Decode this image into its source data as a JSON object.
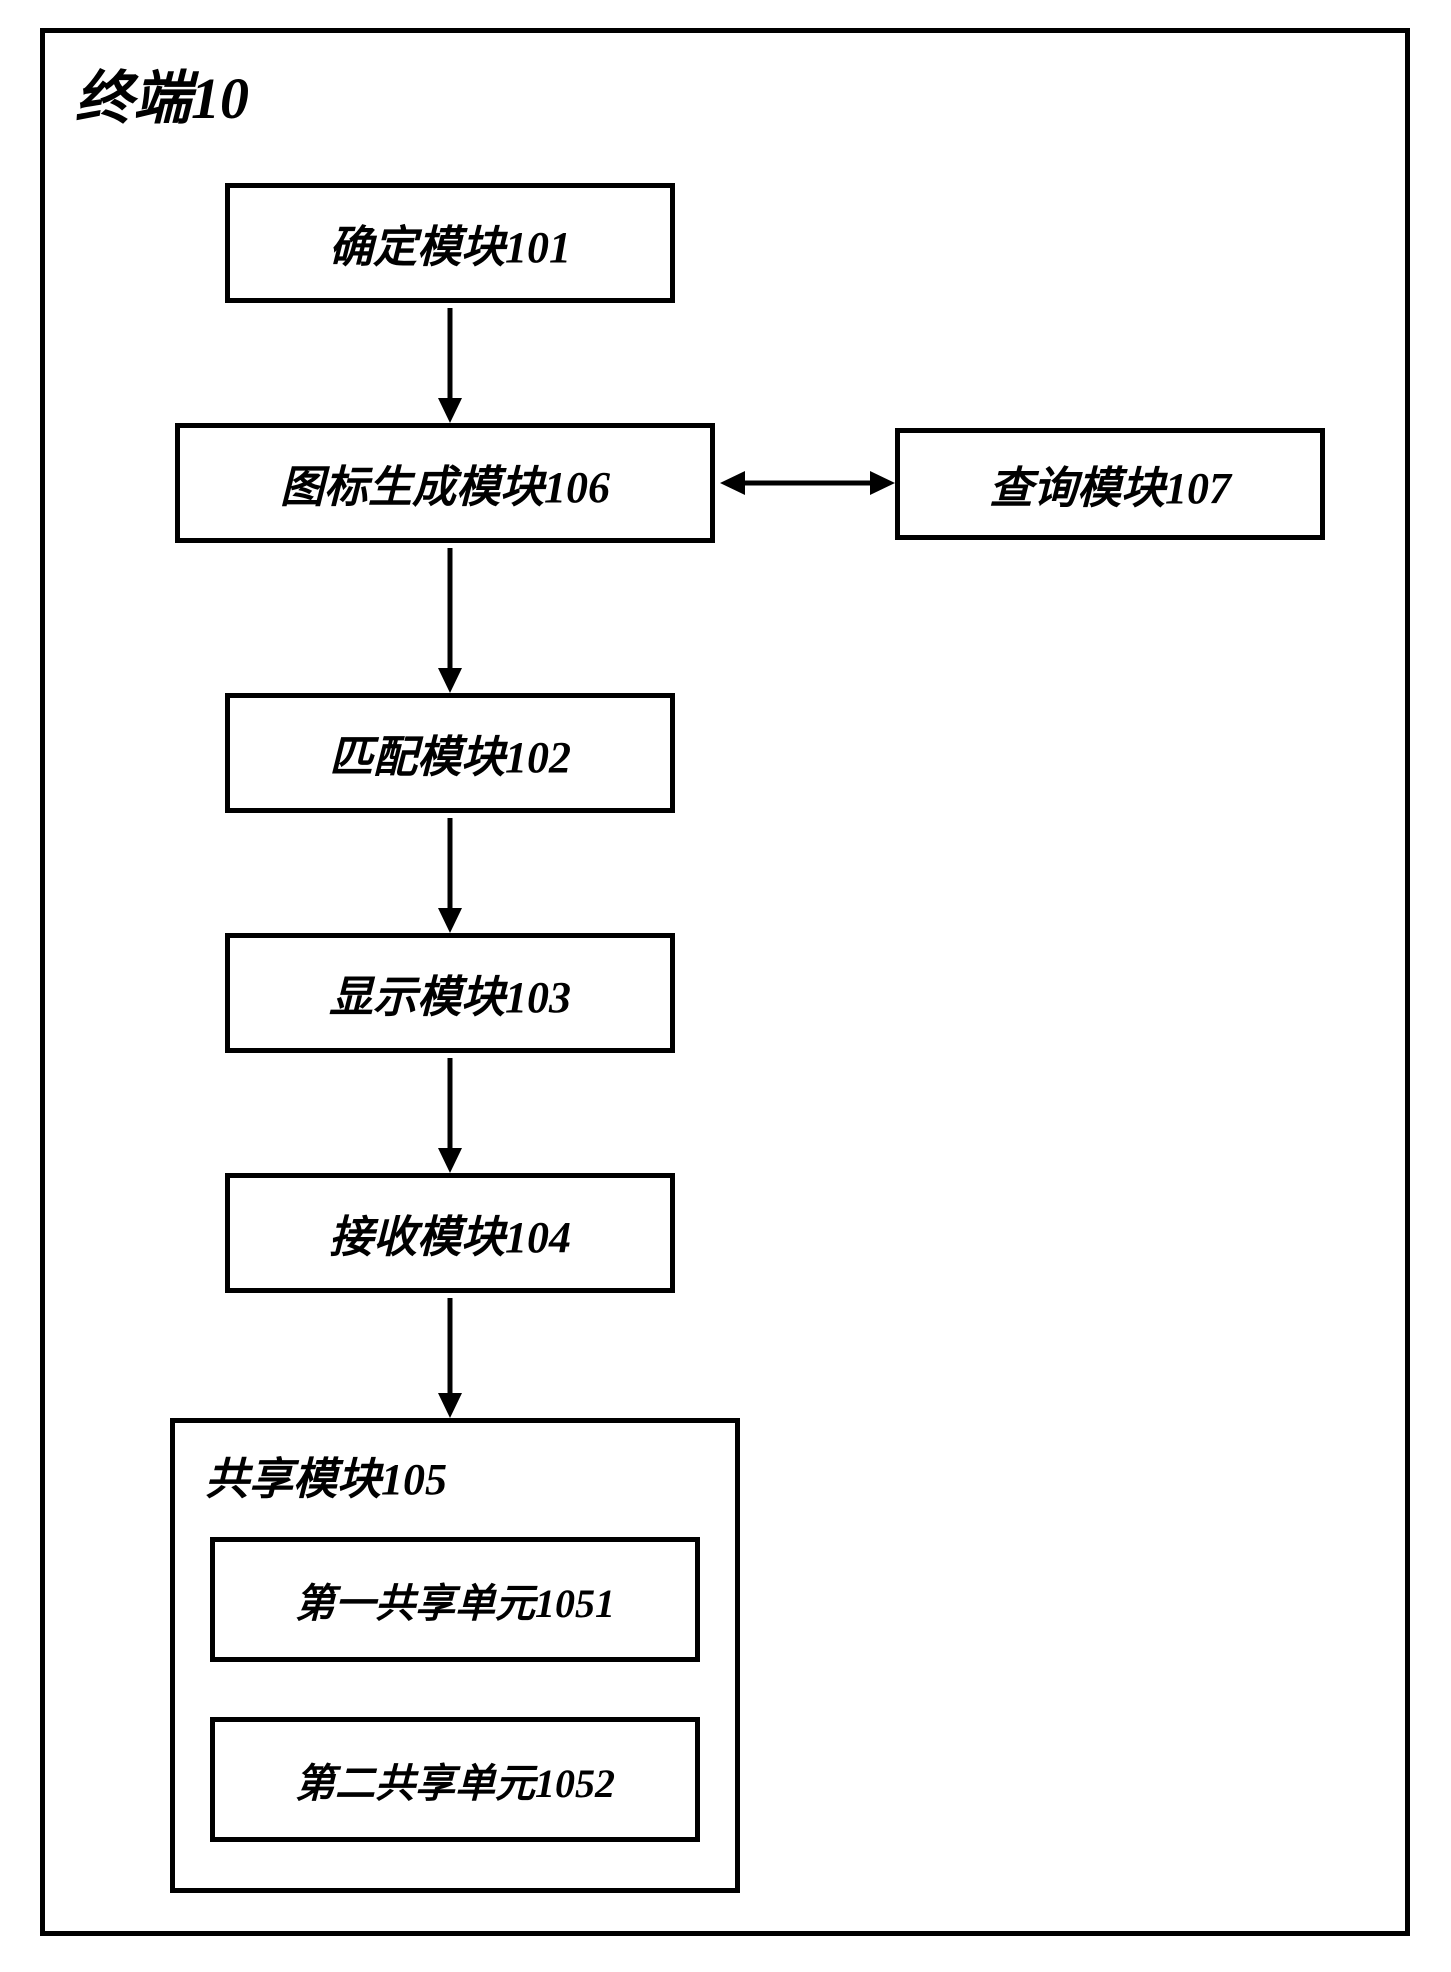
{
  "title": "终端10",
  "modules": {
    "m101": "确定模块101",
    "m106": "图标生成模块106",
    "m107": "查询模块107",
    "m102": "匹配模块102",
    "m103": "显示模块103",
    "m104": "接收模块104",
    "m105": "共享模块105",
    "m1051": "第一共享单元1051",
    "m1052": "第二共享单元1052"
  }
}
